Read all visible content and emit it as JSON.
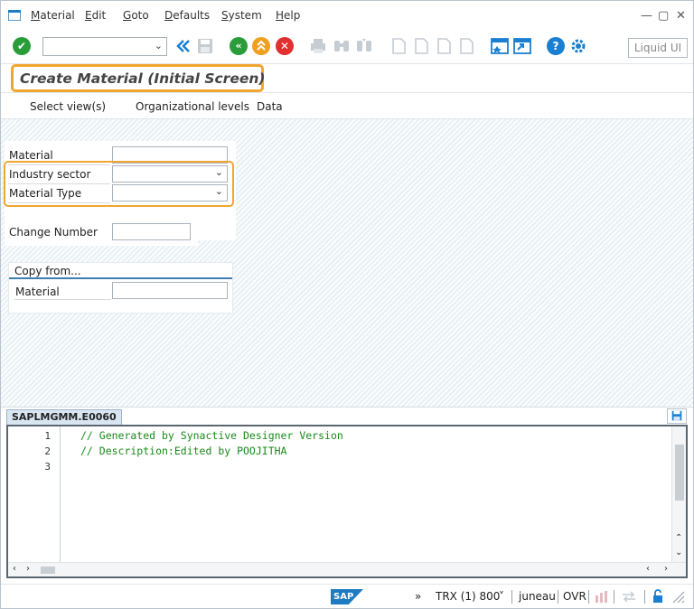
{
  "menubar": {
    "items": [
      {
        "label": "Material",
        "underline": "M",
        "rest": "aterial"
      },
      {
        "label": "Edit",
        "underline": "E",
        "rest": "dit"
      },
      {
        "label": "Goto",
        "underline": "G",
        "rest": "oto"
      },
      {
        "label": "Defaults",
        "underline": "D",
        "rest": "efaults"
      },
      {
        "label": "System",
        "underline": "S",
        "rest": "ystem"
      },
      {
        "label": "Help",
        "underline": "H",
        "rest": "elp"
      }
    ],
    "window_controls": {
      "minimize": "—",
      "maximize": "▢",
      "close": "✕"
    }
  },
  "toolbar": {
    "command_field_value": "",
    "liquid_ui_label": "Liquid UI",
    "icons": [
      "enter-icon",
      "save-icon",
      "back-icon",
      "exit-icon",
      "cancel-icon",
      "print-icon",
      "find-icon",
      "find-next-icon",
      "first-page-icon",
      "previous-page-icon",
      "next-page-icon",
      "last-page-icon",
      "create-session-icon",
      "shortcut-icon",
      "help-icon",
      "customize-icon"
    ],
    "colors": {
      "enter": "#2a9d3a",
      "back": "#2a9d3a",
      "exit": "#f0a020",
      "cancel": "#e03030",
      "help": "#1a7fd0",
      "nav": "#1a7fd0"
    }
  },
  "title": {
    "text": "Create Material (Initial Screen)",
    "highlight_color": "#f2a531"
  },
  "app_toolbar": {
    "buttons": [
      "Select view(s)",
      "Organizational levels",
      "Data"
    ]
  },
  "form": {
    "material_label": "Material",
    "material_value": "",
    "industry_sector_label": "Industry sector",
    "industry_sector_value": "",
    "material_type_label": "Material Type",
    "material_type_value": "",
    "change_number_label": "Change Number",
    "change_number_value": "",
    "copy_from": {
      "title": "Copy from...",
      "material_label": "Material",
      "material_value": ""
    }
  },
  "editor": {
    "tab_label": "SAPLMGMM.E0060",
    "line_numbers": [
      "1",
      "2",
      "3"
    ],
    "lines": [
      "// Generated by Synactive Designer Version",
      "// Description:Edited by POOJITHA",
      ""
    ]
  },
  "statusbar": {
    "brand": "SAP",
    "expand": "»",
    "transaction": "TRX (1) 800",
    "transaction_arrow": "˅",
    "user": "juneau",
    "mode": "OVR"
  }
}
